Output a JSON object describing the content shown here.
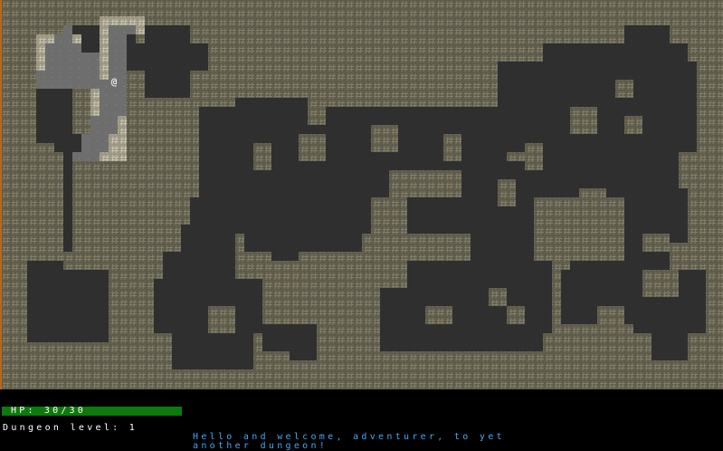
{
  "game": {
    "player_symbol": "@",
    "wall_symbol": "#"
  },
  "status": {
    "hp_label": "HP",
    "hp_current": 30,
    "hp_max": 30,
    "hp_text": "HP: 30/30",
    "hp_fraction": 1.0,
    "dungeon_level_text": "Dungeon level: 1"
  },
  "messages": [
    "Hello and welcome, adventurer, to yet",
    "another dungeon!"
  ],
  "colors": {
    "wall": "#827e68",
    "wall_lit": "#c8c4ae",
    "floor_dark": "#2f2f2f",
    "floor_lit": "#6e6e6e",
    "hp_bar_fill": "#0d7a0d",
    "hp_bar_empty": "#3a0000",
    "message": "#3fa9f5",
    "border": "#b56a1c"
  }
}
